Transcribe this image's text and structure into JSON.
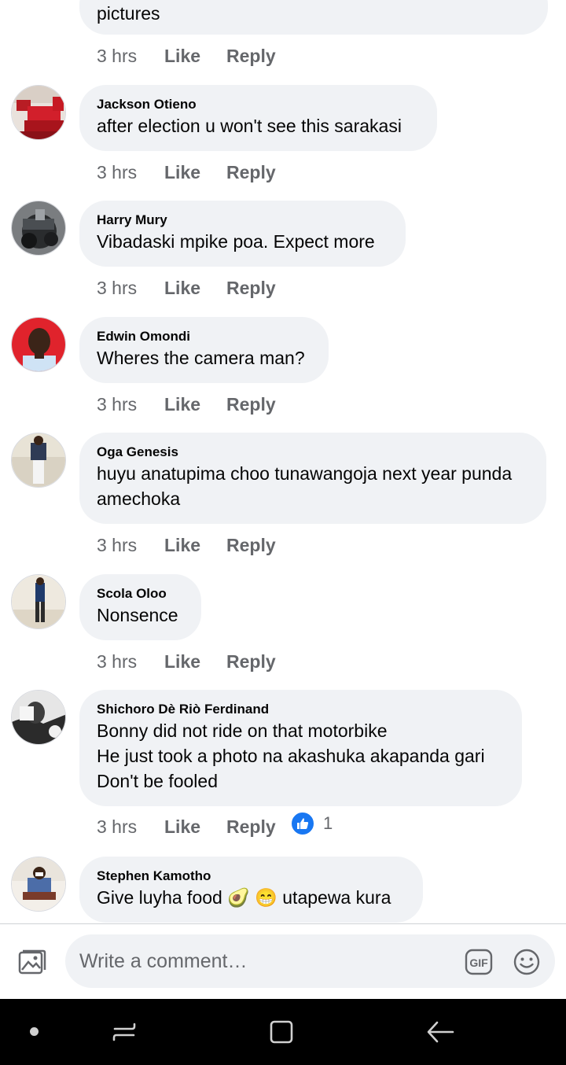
{
  "comments": [
    {
      "author": "",
      "text": "pictures",
      "time": "3 hrs",
      "like": "Like",
      "reply": "Reply",
      "avatar": ""
    },
    {
      "author": "Jackson Otieno",
      "text": "after election u won't see this sarakasi",
      "time": "3 hrs",
      "like": "Like",
      "reply": "Reply",
      "avatar": "red-bedroom"
    },
    {
      "author": "Harry Mury",
      "text": "Vibadaski mpike poa. Expect more",
      "time": "3 hrs",
      "like": "Like",
      "reply": "Reply",
      "avatar": "motorbike"
    },
    {
      "author": "Edwin Omondi",
      "text": "Wheres the camera man?",
      "time": "3 hrs",
      "like": "Like",
      "reply": "Reply",
      "avatar": "man-red-background"
    },
    {
      "author": "Oga Genesis",
      "text": "huyu anatupima choo tunawangoja next year punda amechoka",
      "time": "3 hrs",
      "like": "Like",
      "reply": "Reply",
      "avatar": "man-standing-outdoors"
    },
    {
      "author": "Scola Oloo",
      "text": "Nonsence",
      "time": "3 hrs",
      "like": "Like",
      "reply": "Reply",
      "avatar": "man-walking"
    },
    {
      "author": "Shichoro Dè Riò Ferdinand",
      "text": "Bonny did not ride on that motorbike\nHe just took a photo na akashuka akapanda gari\nDon't be fooled",
      "time": "3 hrs",
      "like": "Like",
      "reply": "Reply",
      "avatar": "black-white-portrait",
      "reaction_count": "1"
    },
    {
      "author": "Stephen Kamotho",
      "text": "Give luyha food 🥑 😁 utapewa kura",
      "time": "",
      "like": "",
      "reply": "",
      "avatar": "man-seated"
    }
  ],
  "composer": {
    "placeholder": "Write a comment…",
    "photo_icon": "photo-icon",
    "gif_label": "GIF",
    "emoji_icon": "smiley-icon"
  },
  "colors": {
    "bubble": "#f0f2f5",
    "meta_text": "#65676b",
    "like_blue": "#1877f2",
    "nav_bar": "#000000"
  }
}
